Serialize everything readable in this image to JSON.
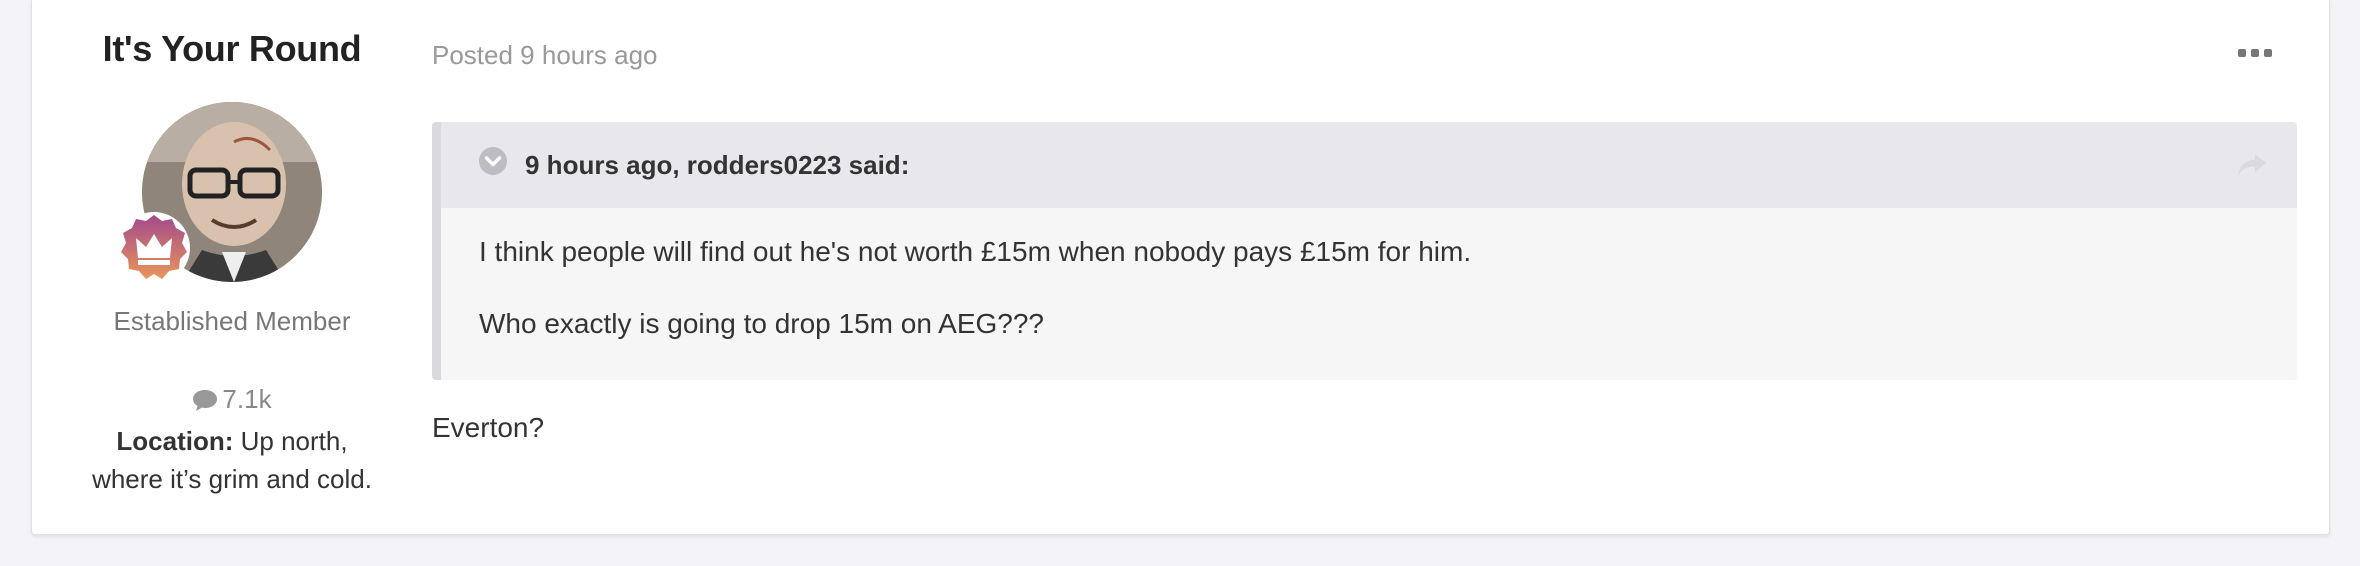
{
  "author": {
    "name": "It's Your Round",
    "rank_title": "Established Member",
    "post_count": "7.1k",
    "location_label": "Location:",
    "location_value": "Up north, where it’s grim and cold."
  },
  "post": {
    "posted_time": "Posted 9 hours ago",
    "more_icon": "ellipsis-icon",
    "quote": {
      "citation": "9 hours ago, rodders0223 said:",
      "paragraphs": [
        "I think people will find out he's not worth £15m when nobody pays £15m for him.",
        "Who exactly is going to drop 15m on AEG???"
      ]
    },
    "body": "Everton?"
  },
  "colors": {
    "background": "#f3f3f8",
    "card": "#ffffff",
    "quote_bg": "#f6f6f6",
    "quote_header_bg": "#e8e8ec",
    "muted_text": "#999999",
    "badge_gradient_top": "#a34a8c",
    "badge_gradient_bottom": "#e8955a"
  }
}
